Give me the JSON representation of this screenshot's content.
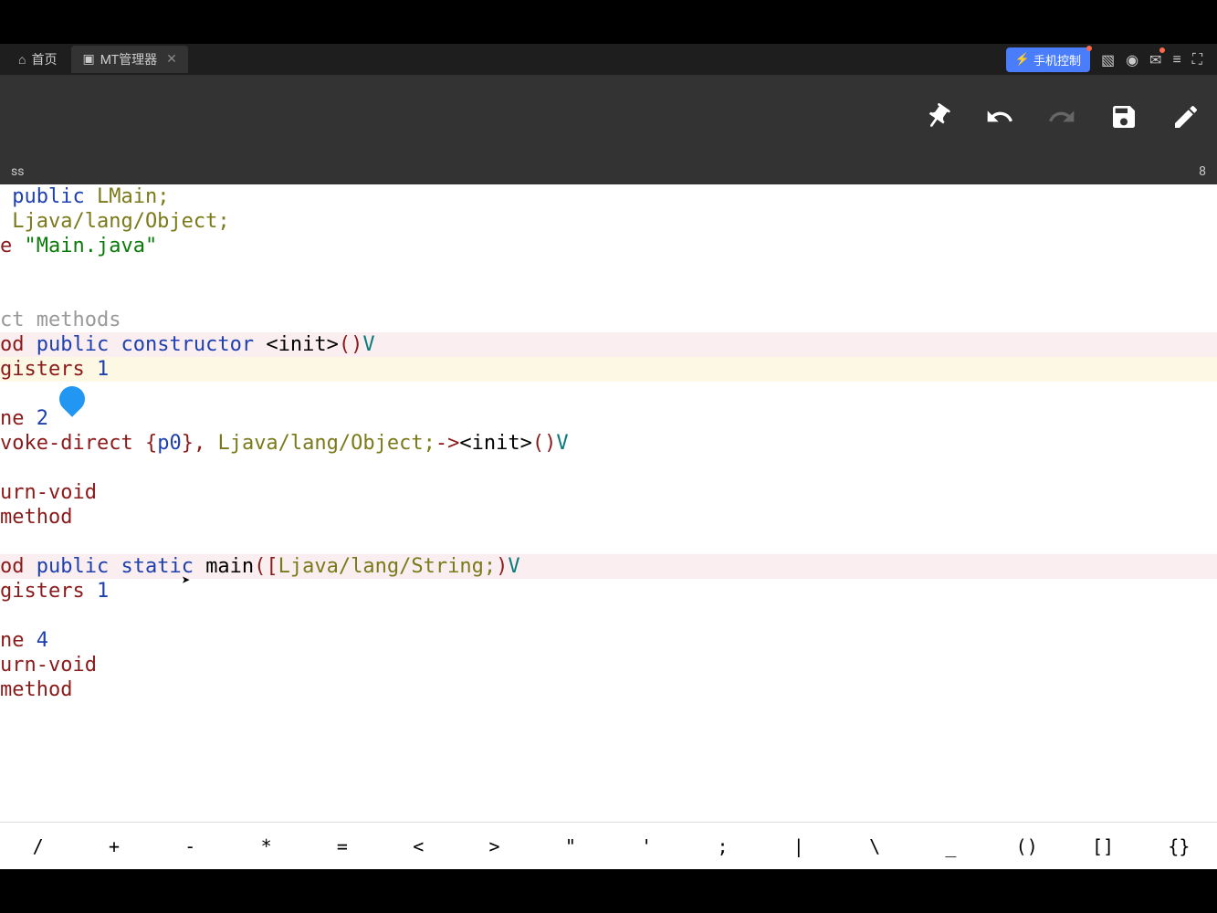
{
  "tabs": {
    "home": {
      "label": "首页",
      "icon": "⌂"
    },
    "mt": {
      "label": "MT管理器",
      "icon": "▣"
    }
  },
  "phone_control": "手机控制",
  "status": {
    "left": "ss",
    "right": "8"
  },
  "code": {
    "line1_kw": " public ",
    "line1_cls": "LMain;",
    "line2": " Ljava/lang/Object;",
    "line3_pre": "e ",
    "line3_str": "\"Main.java\"",
    "comment": "ct methods",
    "m1_prefix": "od ",
    "m1_kw": "public constructor ",
    "m1_name": "<init>",
    "m1_paren": "()",
    "m1_ret": "V",
    "m1_reg_prefix": "gisters ",
    "m1_reg_num": "1",
    "ln1_prefix": "ne ",
    "ln1_num": "2",
    "invoke_prefix": "voke-direct ",
    "invoke_brace1": "{",
    "invoke_p0": "p0",
    "invoke_brace2": "}, ",
    "invoke_cls": "Ljava/lang/Object;",
    "invoke_arrow": "->",
    "invoke_m": "<init>",
    "invoke_paren": "()",
    "invoke_ret": "V",
    "retvoid": "urn-void",
    "endm": "method",
    "m2_prefix": "od ",
    "m2_kw": "public static ",
    "m2_name": "main",
    "m2_paren1": "(",
    "m2_arr": "[",
    "m2_cls": "Ljava/lang/String;",
    "m2_paren2": ")",
    "m2_ret": "V",
    "m2_reg_prefix": "gisters ",
    "m2_reg_num": "1",
    "ln2_prefix": "ne ",
    "ln2_num": "4"
  },
  "symbols": [
    "/",
    "+",
    "-",
    "*",
    "=",
    "<",
    ">",
    "\"",
    "'",
    ";",
    "|",
    "\\",
    "_",
    "()",
    "[]",
    "{}"
  ]
}
